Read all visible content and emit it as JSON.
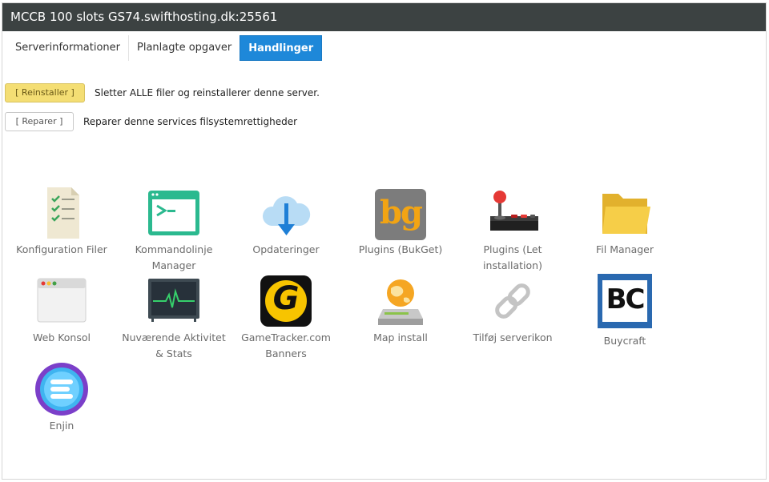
{
  "window": {
    "title": "MCCB 100 slots GS74.swifthosting.dk:25561"
  },
  "tabs": [
    {
      "label": "Serverinformationer"
    },
    {
      "label": "Planlagte opgaver"
    },
    {
      "label": "Handlinger",
      "active": true
    }
  ],
  "actions": {
    "reinstall": {
      "button": "[ Reinstaller ]",
      "description": "Sletter ALLE filer og reinstallerer denne server."
    },
    "repair": {
      "button": "[ Reparer ]",
      "description": "Reparer denne services filsystemrettigheder"
    }
  },
  "tiles": [
    {
      "label": "Konfiguration Filer",
      "icon": "checklist-document-icon"
    },
    {
      "label": "Kommandolinje Manager",
      "icon": "terminal-icon"
    },
    {
      "label": "Opdateringer",
      "icon": "cloud-download-icon"
    },
    {
      "label": "Plugins (BukGet)",
      "icon": "bukget-logo-icon"
    },
    {
      "label": "Plugins (Let installation)",
      "icon": "joystick-icon"
    },
    {
      "label": "Fil Manager",
      "icon": "folder-icon"
    },
    {
      "label": "Web Konsol",
      "icon": "browser-window-icon"
    },
    {
      "label": "Nuværende Aktivitet & Stats",
      "icon": "activity-monitor-icon"
    },
    {
      "label": "GameTracker.com Banners",
      "icon": "gametracker-logo-icon"
    },
    {
      "label": "Map install",
      "icon": "globe-drive-icon"
    },
    {
      "label": "Tilføj serverikon",
      "icon": "chain-link-icon"
    },
    {
      "label": "Buycraft",
      "icon": "buycraft-logo-icon"
    },
    {
      "label": "Enjin",
      "icon": "enjin-logo-icon"
    }
  ],
  "icon_text": {
    "bukget": "bg",
    "gametracker": "G",
    "buycraft": "BC"
  },
  "colors": {
    "header_bg": "#3c4242",
    "active_tab": "#1e88d9",
    "reinstall_button": "#f4de74"
  }
}
